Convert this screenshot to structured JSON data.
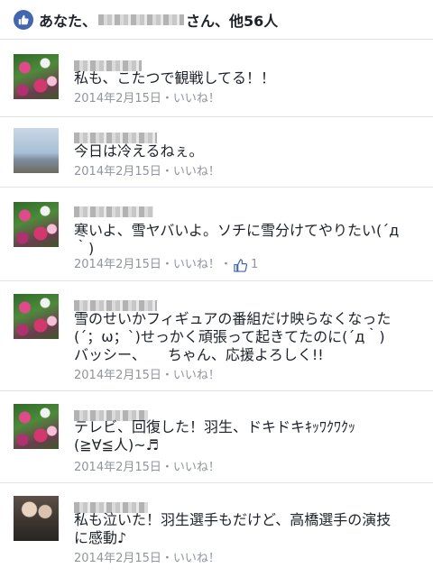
{
  "likes_summary": {
    "text_prefix": "あなた、",
    "text_suffix": "さん、他56人"
  },
  "comments": [
    {
      "text": "私も、こたつで観戦してる！！",
      "date": "2014年2月15日",
      "like_action": "いいね！"
    },
    {
      "text": "今日は冷えるねぇ。",
      "date": "2014年2月15日",
      "like_action": "いいね！"
    },
    {
      "text": "寒いよ、雪ヤバいよ。ソチに雪分けてやりたい(´д\n｀)",
      "date": "2014年2月15日",
      "like_action": "いいね！",
      "like_count": "1"
    },
    {
      "text": "雪のせいかフィギュアの番組だけ映らなくなった\n(´；ω；`)せっかく頑張って起きてたのに(´д｀)\nバッシー、　　ちゃん、応援よろしく!!",
      "date": "2014年2月15日",
      "like_action": "いいね！"
    },
    {
      "text": "テレビ、回復した！羽生、ドキドキｷｯﾜｸﾜｸｯ\n(≧∀≦人)~♬",
      "date": "2014年2月15日",
      "like_action": "いいね！"
    },
    {
      "text": "私も泣いた！羽生選手もだけど、高橋選手の演技\nに感動♪",
      "date": "2014年2月15日",
      "like_action": "いいね！"
    }
  ],
  "separator": "・",
  "colors": {
    "accent": "#4267b2",
    "meta": "#90949c",
    "text": "#1d2129"
  }
}
